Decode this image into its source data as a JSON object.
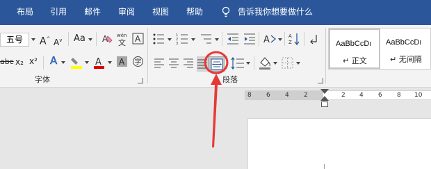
{
  "tabs": [
    "布局",
    "引用",
    "邮件",
    "审阅",
    "视图",
    "帮助"
  ],
  "tell_me": "告诉我你想要做什么",
  "font": {
    "size_value": "五号",
    "group_label": "字体",
    "increase_icon": "A",
    "decrease_icon": "A",
    "change_case": "Aa",
    "clear_format": "清",
    "phonetic": "wén",
    "border_char": "A",
    "strikethrough": "abc",
    "subscript": "x₂",
    "superscript": "x²",
    "text_effect": "A",
    "highlight_icon": "ab",
    "font_color": "A",
    "char_shading": "A",
    "enclose_char": "字"
  },
  "paragraph": {
    "group_label": "段落"
  },
  "styles": {
    "items": [
      {
        "sample": "AaBbCcDı",
        "name": "正文"
      },
      {
        "sample": "AaBbCcDı",
        "name": "无间隔"
      }
    ]
  },
  "ruler": {
    "numbers": [
      "8",
      "6",
      "4",
      "2",
      "2",
      "4",
      "6",
      "8",
      "10"
    ]
  },
  "colors": {
    "tab_bar": "#2b579a",
    "highlight_yellow": "#ffff00",
    "font_red": "#e00000",
    "annotation_red": "#e53935"
  }
}
